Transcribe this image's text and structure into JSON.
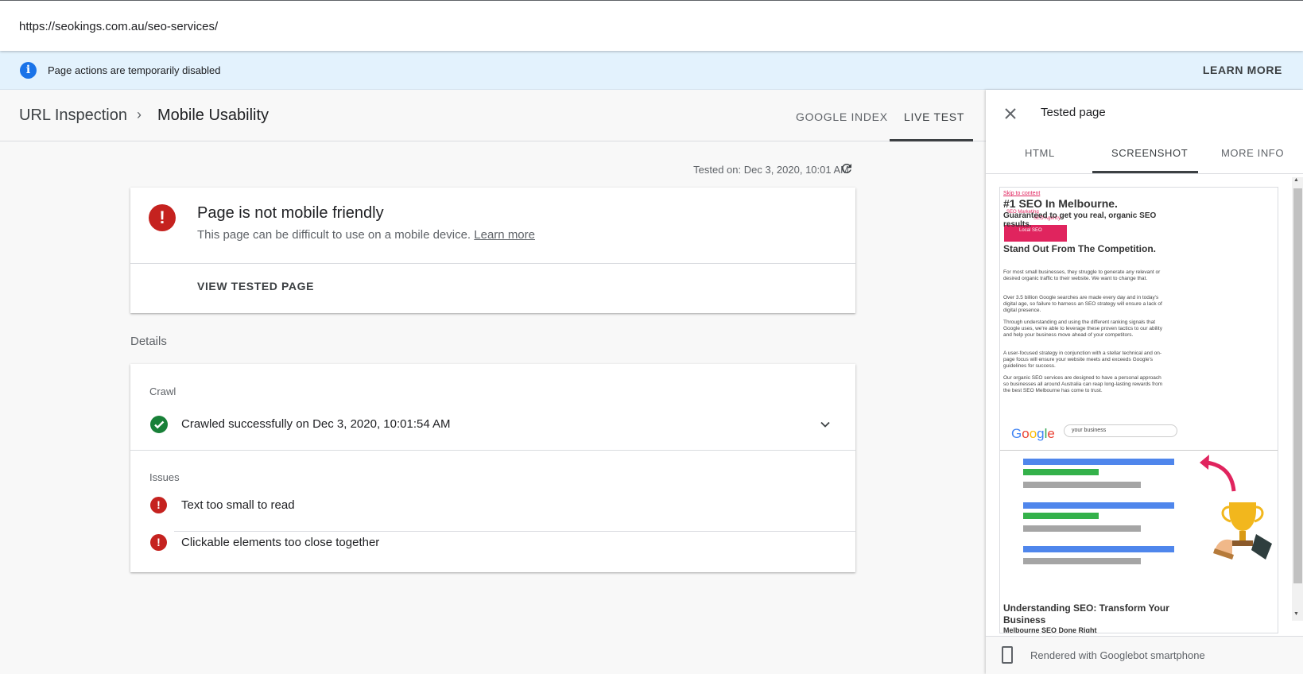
{
  "browser": {
    "url": "https://seokings.com.au/seo-services/"
  },
  "banner": {
    "message": "Page actions are temporarily disabled",
    "action": "LEARN MORE"
  },
  "header": {
    "breadcrumb": [
      "URL Inspection",
      "Mobile Usability"
    ],
    "tabs": [
      "GOOGLE INDEX",
      "LIVE TEST"
    ],
    "active_tab": "LIVE TEST"
  },
  "main": {
    "tested_on": "Tested on: Dec 3, 2020, 10:01 AM",
    "status_title": "Page is not mobile friendly",
    "status_sub": "This page can be difficult to use on a mobile device.",
    "learn_more": "Learn more",
    "view_tested": "VIEW TESTED PAGE",
    "details_label": "Details",
    "crawl_label": "Crawl",
    "crawl_status": "Crawled successfully on Dec 3, 2020, 10:01:54 AM",
    "issues_label": "Issues",
    "issues": [
      "Text too small to read",
      "Clickable elements too close together"
    ]
  },
  "panel": {
    "title": "Tested page",
    "tabs": [
      "HTML",
      "SCREENSHOT",
      "MORE INFO"
    ],
    "active_tab": "SCREENSHOT",
    "footer": "Rendered with Googlebot smartphone"
  },
  "screenshot": {
    "skip": "Skip to content",
    "heading": "#1 SEO In Melbourne.",
    "subheading": "Guaranteed to get you real, organic SEO results.",
    "menu": [
      "SEO Marketing",
      "SEO Agency",
      "Local SEO"
    ],
    "h2": "Stand Out From The Competition.",
    "paragraphs": [
      "For most small businesses, they struggle to generate any relevant or desired organic traffic to their website. We want to change that.",
      "Over 3.5 billion Google searches are made every day and in today's digital age, so failure to harness an SEO strategy will ensure a lack of digital presence.",
      "Through understanding and using the different ranking signals that Google uses, we're able to leverage these proven tactics to our ability and help your business move ahead of your competitors.",
      "A user-focused strategy in conjunction with a stellar technical and on-page focus will ensure your website meets and exceeds Google's guidelines for success.",
      "Our organic SEO services are designed to have a personal approach so businesses all around Australia can reap long-lasting rewards from the best SEO Melbourne has come to trust."
    ],
    "google_logo": "Google",
    "search_text": "your business",
    "h3": "Understanding SEO: Transform Your Business",
    "h3sub": "Melbourne SEO Done Right"
  },
  "colors": {
    "error": "#c5221f",
    "success": "#188038",
    "banner": "#e3f2fd",
    "info": "#1a73e8",
    "brand_pink": "#e0245e"
  }
}
